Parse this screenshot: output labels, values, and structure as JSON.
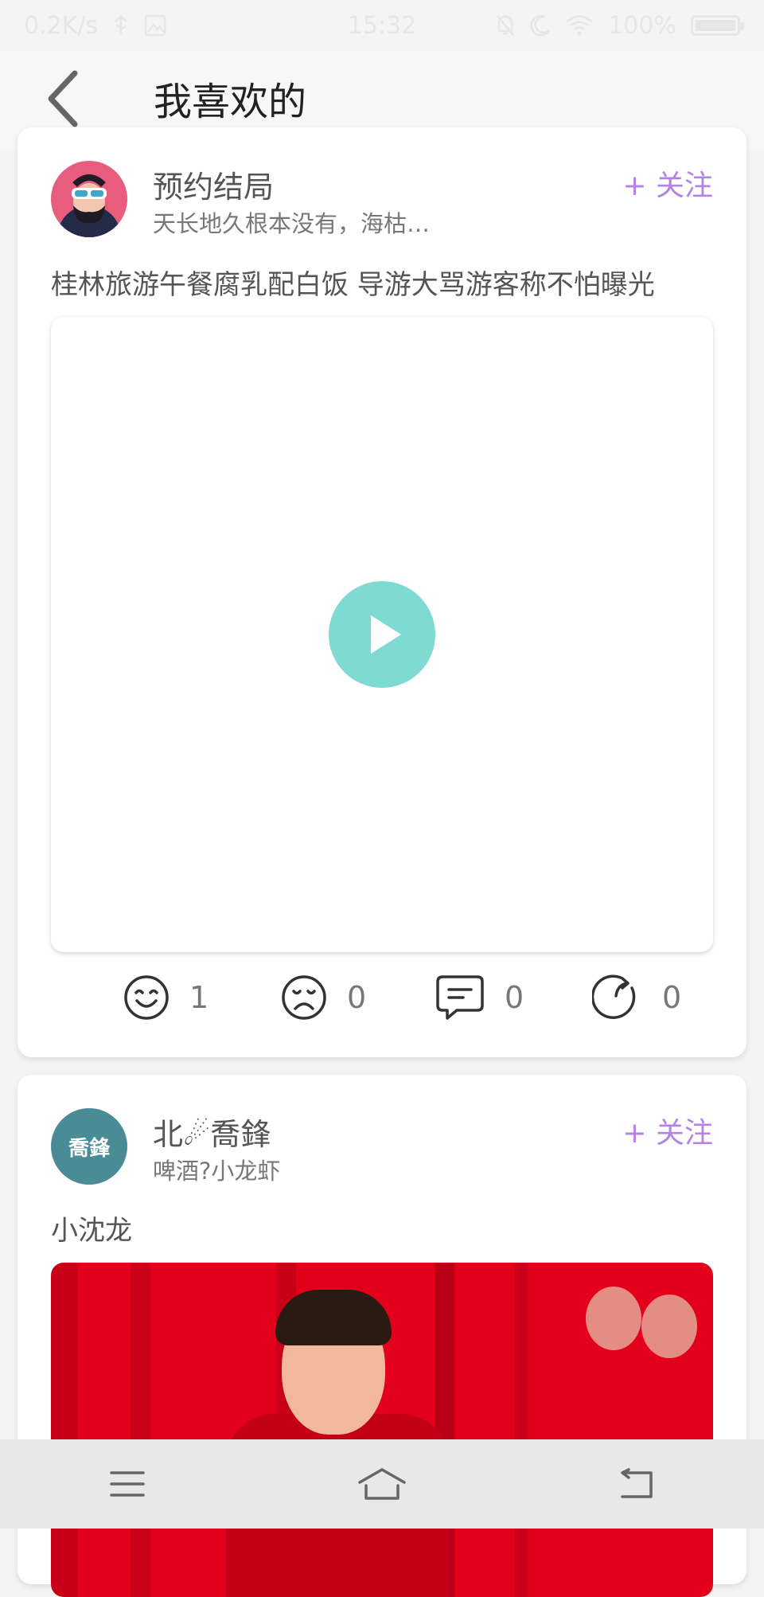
{
  "status_bar": {
    "network_speed": "0.2K/s",
    "time": "15:32",
    "battery": "100%"
  },
  "header": {
    "title": "我喜欢的"
  },
  "posts": [
    {
      "username": "预约结局",
      "signature": "天长地久根本没有，海枯…",
      "follow_label": "+ 关注",
      "title": "桂林旅游午餐腐乳配白饭 导游大骂游客称不怕曝光",
      "stats": {
        "like_count": "1",
        "dislike_count": "0",
        "comment_count": "0",
        "share_count": "0"
      }
    },
    {
      "username": "北☄喬鋒",
      "avatar_text": "喬鋒",
      "signature": "啤酒?小龙虾",
      "follow_label": "+ 关注",
      "title": "小沈龙"
    }
  ],
  "colors": {
    "accent": "#b383e6",
    "play_button": "#7fdad2",
    "avatar2_bg": "#4a8c96"
  }
}
